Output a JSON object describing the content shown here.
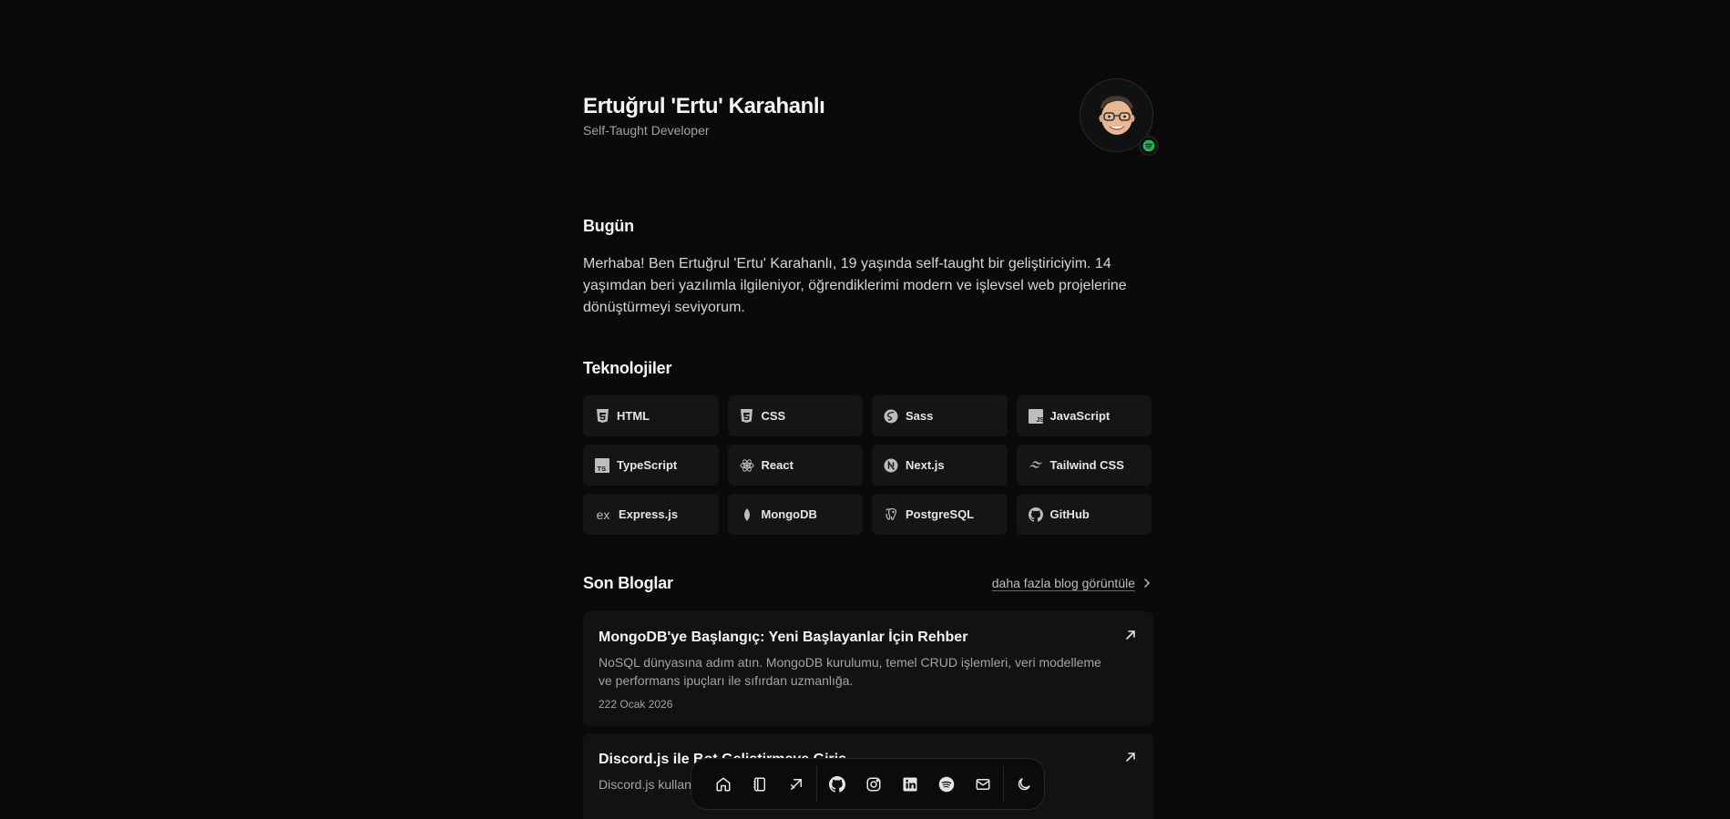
{
  "header": {
    "name": "Ertuğrul 'Ertu' Karahanlı",
    "role": "Self-Taught Developer"
  },
  "about": {
    "title": "Bugün",
    "text": "Merhaba! Ben Ertuğrul 'Ertu' Karahanlı, 19 yaşında self-taught bir geliştiriciyim. 14 yaşımdan beri yazılımla ilgileniyor, öğrendiklerimi modern ve işlevsel web projelerine dönüştürmeyi seviyorum."
  },
  "tech": {
    "title": "Teknolojiler",
    "items": [
      {
        "label": "HTML",
        "icon": "html5-icon"
      },
      {
        "label": "CSS",
        "icon": "css3-icon"
      },
      {
        "label": "Sass",
        "icon": "sass-icon"
      },
      {
        "label": "JavaScript",
        "icon": "javascript-icon"
      },
      {
        "label": "TypeScript",
        "icon": "typescript-icon"
      },
      {
        "label": "React",
        "icon": "react-icon"
      },
      {
        "label": "Next.js",
        "icon": "nextjs-icon"
      },
      {
        "label": "Tailwind CSS",
        "icon": "tailwind-icon"
      },
      {
        "label": "Express.js",
        "icon": "express-icon"
      },
      {
        "label": "MongoDB",
        "icon": "mongodb-icon"
      },
      {
        "label": "PostgreSQL",
        "icon": "postgresql-icon"
      },
      {
        "label": "GitHub",
        "icon": "github-icon"
      }
    ]
  },
  "blogs": {
    "title": "Son Bloglar",
    "more_label": "daha fazla blog görüntüle",
    "posts": [
      {
        "title": "MongoDB'ye Başlangıç: Yeni Başlayanlar İçin Rehber",
        "description": "NoSQL dünyasına adım atın. MongoDB kurulumu, temel CRUD işlemleri, veri modelleme ve performans ipuçları ile sıfırdan uzmanlığa.",
        "date": "222 Ocak 2026"
      },
      {
        "title": "Discord.js ile Bot Geliştirmeye Giriş",
        "description": "Discord.js kullan... komutlara, olay yönetimind..."
      }
    ]
  },
  "dock": {
    "items": [
      "home-icon",
      "notebook-icon",
      "arrow-up-right-icon",
      "github-icon",
      "instagram-icon",
      "linkedin-icon",
      "spotify-icon",
      "mail-icon",
      "moon-icon"
    ]
  },
  "colors": {
    "background": "#0a0a0a",
    "card": "#151515",
    "text": "#ededed",
    "muted": "#a3a3a3",
    "spotify": "#1db954"
  }
}
